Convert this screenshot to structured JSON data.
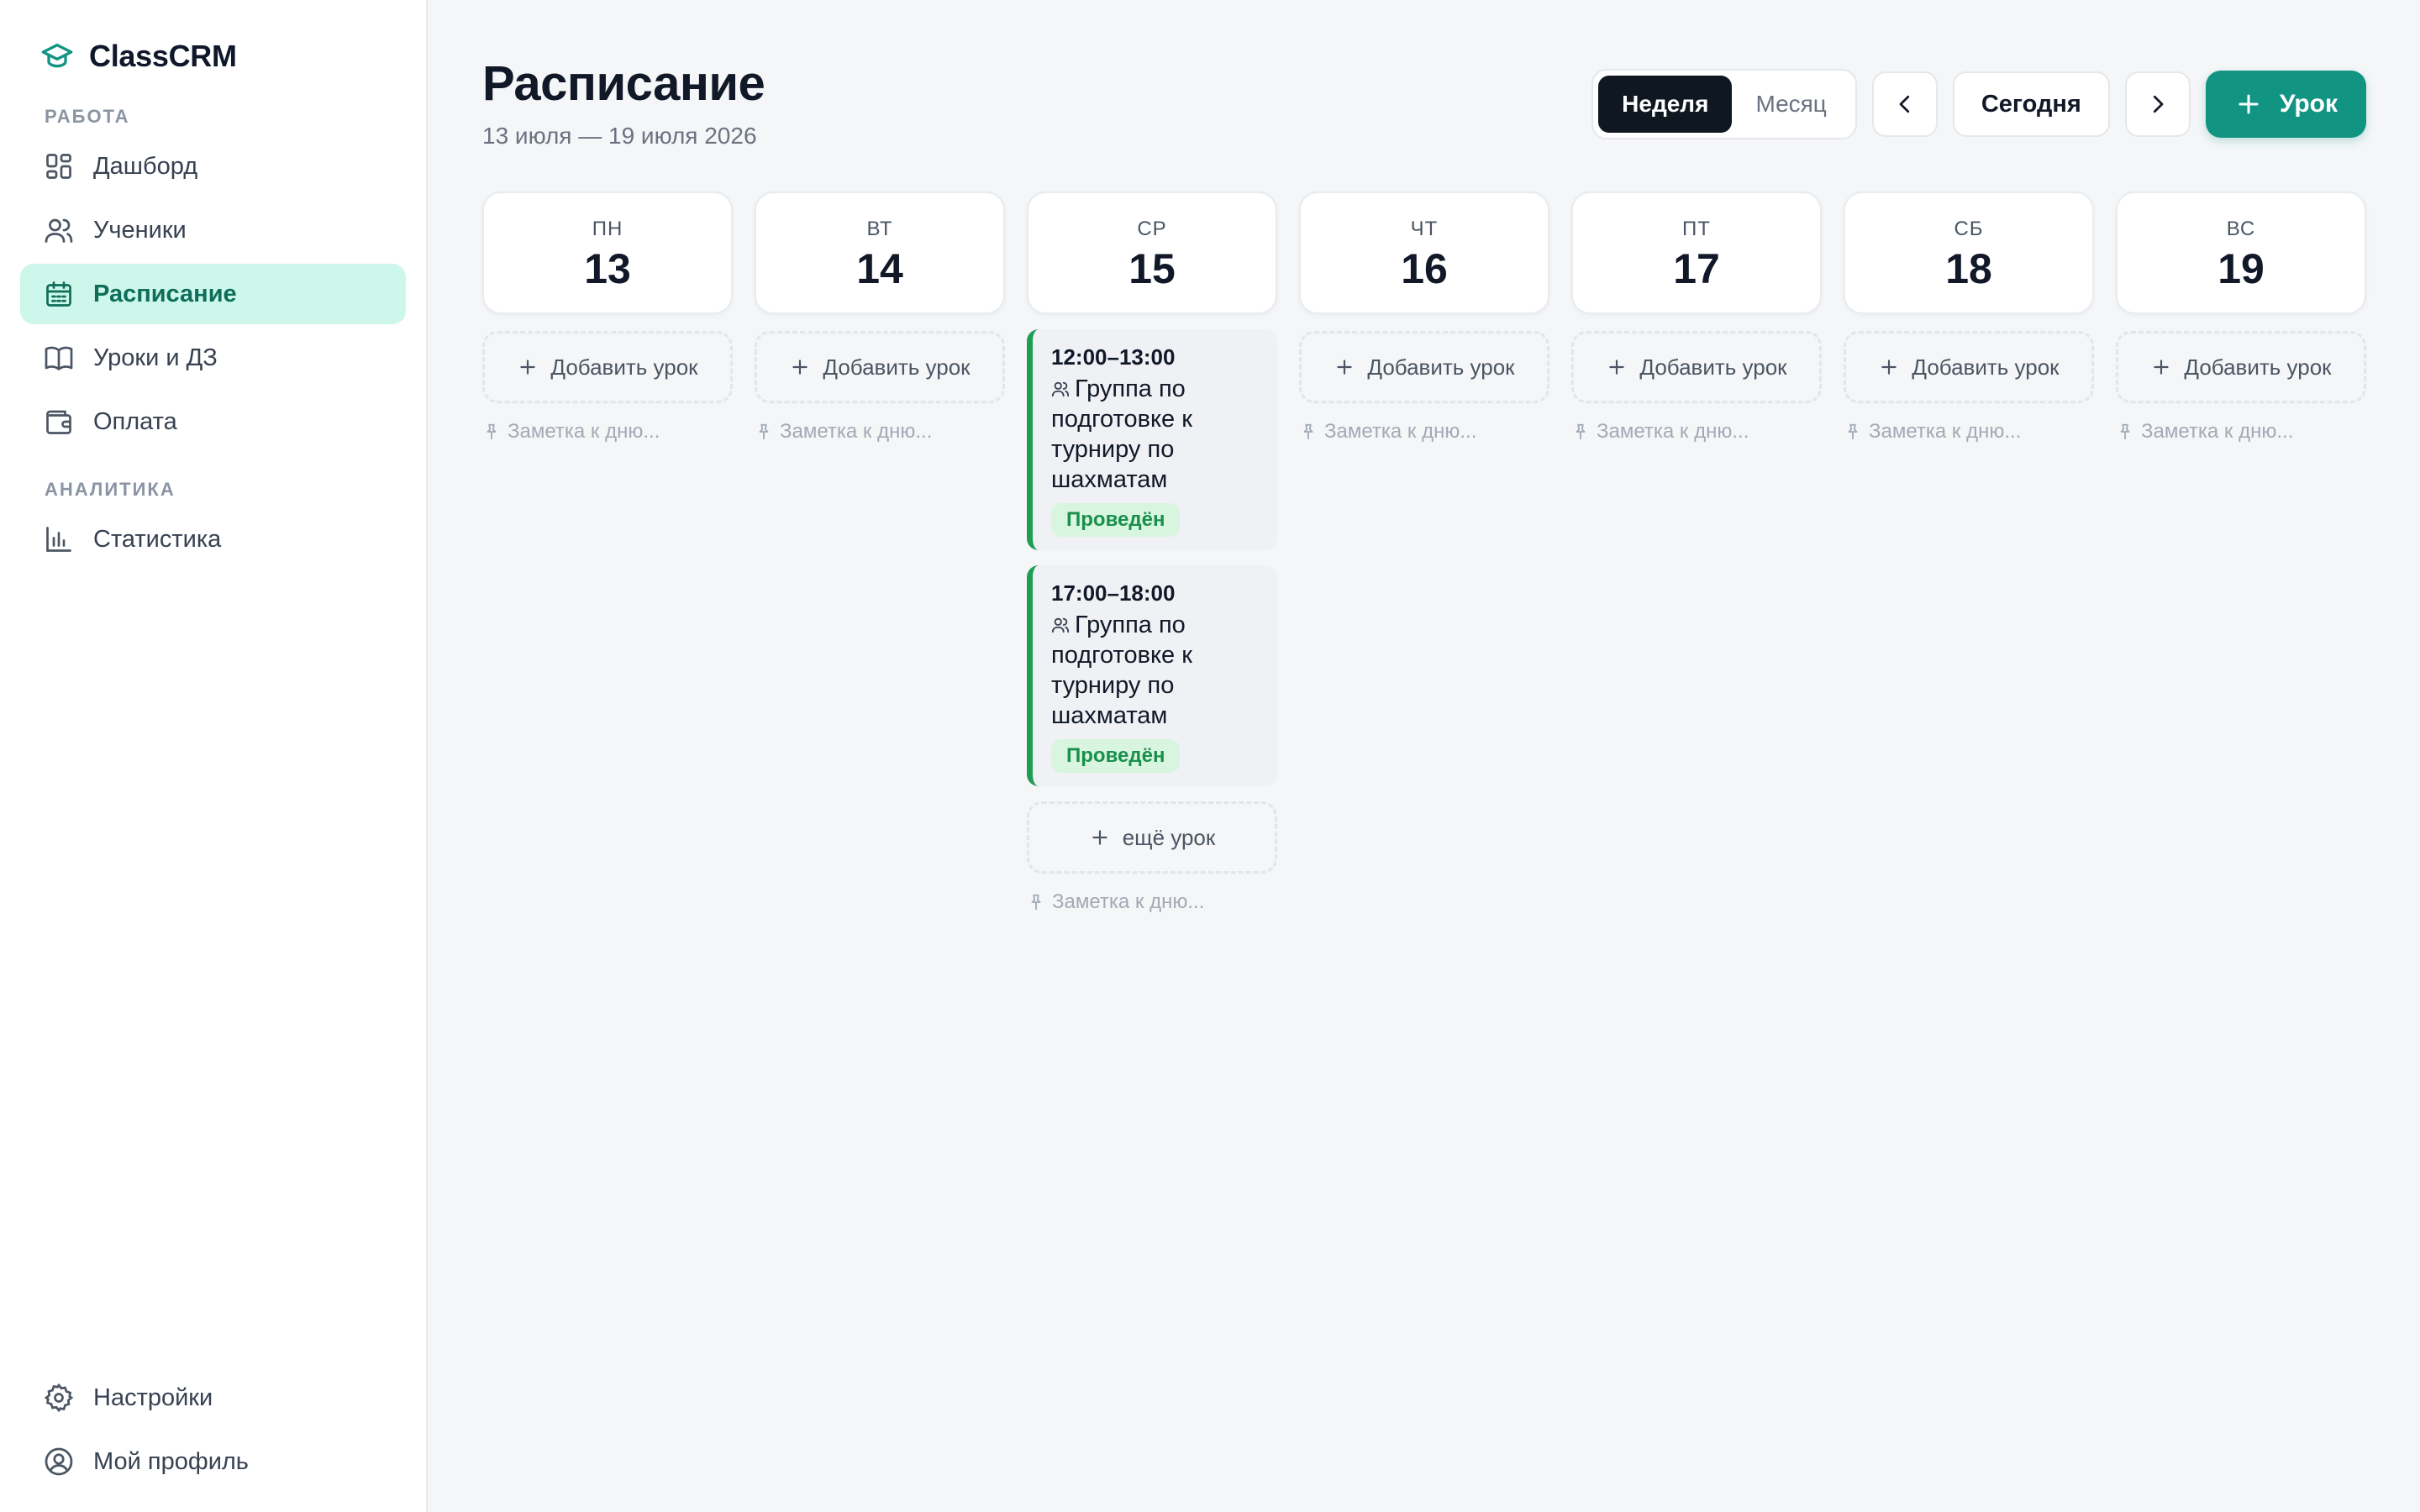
{
  "app": {
    "name": "ClassCRM"
  },
  "sidebar": {
    "sections": [
      {
        "label": "РАБОТА"
      },
      {
        "label": "АНАЛИТИКА"
      }
    ],
    "items": [
      {
        "label": "Дашборд",
        "icon": "dashboard-icon"
      },
      {
        "label": "Ученики",
        "icon": "users-icon"
      },
      {
        "label": "Расписание",
        "icon": "calendar-icon",
        "active": true
      },
      {
        "label": "Уроки и ДЗ",
        "icon": "book-icon"
      },
      {
        "label": "Оплата",
        "icon": "wallet-icon"
      },
      {
        "label": "Статистика",
        "icon": "bar-chart-icon"
      }
    ],
    "bottom": [
      {
        "label": "Настройки",
        "icon": "gear-icon"
      },
      {
        "label": "Мой профиль",
        "icon": "profile-icon"
      }
    ]
  },
  "header": {
    "title": "Расписание",
    "date_range": "13 июля — 19 июля 2026",
    "view_week": "Неделя",
    "view_month": "Месяц",
    "today": "Сегодня",
    "add_lesson": "Урок"
  },
  "week": {
    "add_lesson_label": "Добавить урок",
    "note_placeholder": "Заметка к дню...",
    "more_lesson_label": "ещё урок",
    "days": [
      {
        "dow": "ПН",
        "num": "13"
      },
      {
        "dow": "ВТ",
        "num": "14"
      },
      {
        "dow": "СР",
        "num": "15"
      },
      {
        "dow": "ЧТ",
        "num": "16"
      },
      {
        "dow": "ПТ",
        "num": "17"
      },
      {
        "dow": "СБ",
        "num": "18"
      },
      {
        "dow": "ВС",
        "num": "19"
      }
    ],
    "lessons": [
      {
        "time": "12:00–13:00",
        "title": "Группа по подготовке к турниру по шахматам",
        "status": "Проведён"
      },
      {
        "time": "17:00–18:00",
        "title": "Группа по подготовке к турниру по шахматам",
        "status": "Проведён"
      }
    ]
  },
  "colors": {
    "accent": "#129483",
    "active_nav_bg": "#cdf7ea",
    "lesson_border": "#1f9d55",
    "badge_bg": "#d7f5df"
  }
}
